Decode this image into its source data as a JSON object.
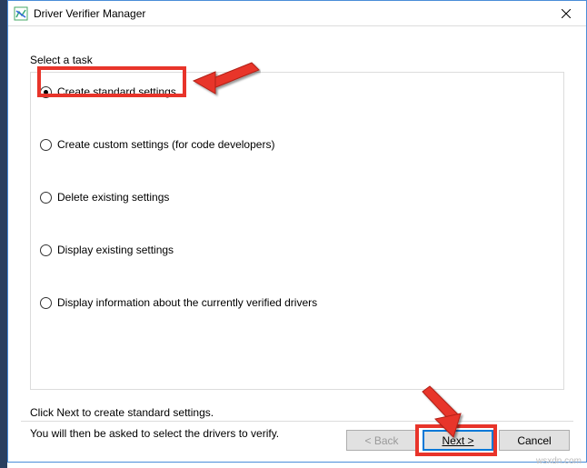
{
  "titlebar": {
    "title": "Driver Verifier Manager"
  },
  "content": {
    "task_label": "Select a task",
    "options": {
      "opt0": "Create standard settings",
      "opt1": "Create custom settings (for code developers)",
      "opt2": "Delete existing settings",
      "opt3": "Display existing settings",
      "opt4": "Display information about the currently verified drivers"
    },
    "hint_line1": "Click Next to create standard settings.",
    "hint_line2": "You will then be asked to select the drivers to verify."
  },
  "buttons": {
    "back": "< Back",
    "next": "Next >",
    "cancel": "Cancel"
  },
  "watermark": "wsxdn.com"
}
